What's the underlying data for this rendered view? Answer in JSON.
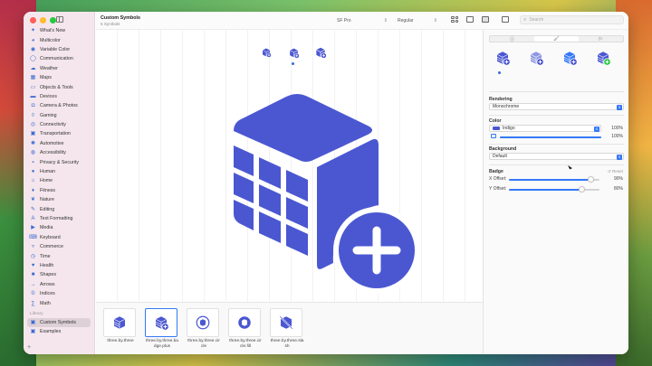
{
  "window": {
    "title": "Custom Symbols",
    "subtitle": "5 Symbols"
  },
  "toolbar": {
    "font_select": "SF Pro",
    "weight_select": "Regular",
    "search_placeholder": "Search"
  },
  "sidebar": {
    "items": [
      {
        "label": "What's New",
        "icon": "star-icon",
        "glyph": "✦"
      },
      {
        "label": "Multicolor",
        "icon": "paintpalette-icon",
        "glyph": "◕"
      },
      {
        "label": "Variable Color",
        "icon": "speaker-wave-icon",
        "glyph": "◉"
      },
      {
        "label": "Communication",
        "icon": "message-icon",
        "glyph": "◯"
      },
      {
        "label": "Weather",
        "icon": "cloud-sun-icon",
        "glyph": "☁"
      },
      {
        "label": "Maps",
        "icon": "map-icon",
        "glyph": "▦"
      },
      {
        "label": "Objects & Tools",
        "icon": "folder-icon",
        "glyph": "▭"
      },
      {
        "label": "Devices",
        "icon": "desktop-icon",
        "glyph": "▬"
      },
      {
        "label": "Camera & Photos",
        "icon": "camera-icon",
        "glyph": "◘"
      },
      {
        "label": "Gaming",
        "icon": "gamecontroller-icon",
        "glyph": "◊"
      },
      {
        "label": "Connectivity",
        "icon": "antenna-icon",
        "glyph": "◎"
      },
      {
        "label": "Transportation",
        "icon": "car-icon",
        "glyph": "▣"
      },
      {
        "label": "Automotive",
        "icon": "steering-wheel-icon",
        "glyph": "✺"
      },
      {
        "label": "Accessibility",
        "icon": "accessibility-icon",
        "glyph": "◍"
      },
      {
        "label": "Privacy & Security",
        "icon": "lock-icon",
        "glyph": "▪"
      },
      {
        "label": "Human",
        "icon": "person-icon",
        "glyph": "●"
      },
      {
        "label": "Home",
        "icon": "house-icon",
        "glyph": "⌂"
      },
      {
        "label": "Fitness",
        "icon": "figure-run-icon",
        "glyph": "♦"
      },
      {
        "label": "Nature",
        "icon": "leaf-icon",
        "glyph": "❦"
      },
      {
        "label": "Editing",
        "icon": "pencil-icon",
        "glyph": "✎"
      },
      {
        "label": "Text Formatting",
        "icon": "textformat-icon",
        "glyph": "A"
      },
      {
        "label": "Media",
        "icon": "play-icon",
        "glyph": "▶"
      },
      {
        "label": "Keyboard",
        "icon": "keyboard-icon",
        "glyph": "⌨"
      },
      {
        "label": "Commerce",
        "icon": "cart-icon",
        "glyph": "▿"
      },
      {
        "label": "Time",
        "icon": "clock-icon",
        "glyph": "◷"
      },
      {
        "label": "Health",
        "icon": "heart-icon",
        "glyph": "♥"
      },
      {
        "label": "Shapes",
        "icon": "shapes-icon",
        "glyph": "■"
      },
      {
        "label": "Arrows",
        "icon": "arrow-icon",
        "glyph": "→"
      },
      {
        "label": "Indices",
        "icon": "indices-icon",
        "glyph": "①"
      },
      {
        "label": "Math",
        "icon": "math-icon",
        "glyph": "∑"
      }
    ],
    "section_library": "Library",
    "library_items": [
      {
        "label": "Custom Symbols",
        "icon": "custom-symbols-icon",
        "glyph": "▣",
        "selected": true
      },
      {
        "label": "Examples",
        "icon": "examples-icon",
        "glyph": "▣",
        "selected": false
      }
    ]
  },
  "strip": {
    "items": [
      {
        "label": "three.by.three"
      },
      {
        "label": "three.by.three.badge.plus"
      },
      {
        "label": "three.by.three.circle"
      },
      {
        "label": "three.by.three.circle.fill"
      },
      {
        "label": "three.by.three.slash"
      }
    ]
  },
  "inspector": {
    "tabs": [
      "ⓘ",
      "🖌",
      "▷"
    ],
    "rendering_label": "Rendering",
    "rendering_value": "Monochrome",
    "color_label": "Color",
    "color_value": "Indigo",
    "color_pct": "100%",
    "opacity_pct": "100%",
    "background_label": "Background",
    "background_value": "Default",
    "badge_label": "Badge",
    "reset_label": "Reset",
    "x_offset_label": "X Offset:",
    "x_offset_value": "90%",
    "x_offset_level": 0.9,
    "y_offset_label": "Y Offset:",
    "y_offset_value": "80%",
    "y_offset_level": 0.8
  },
  "colors": {
    "indigo": "#4b57d1",
    "accent": "#3478f6",
    "badge_green": "#28c840"
  }
}
